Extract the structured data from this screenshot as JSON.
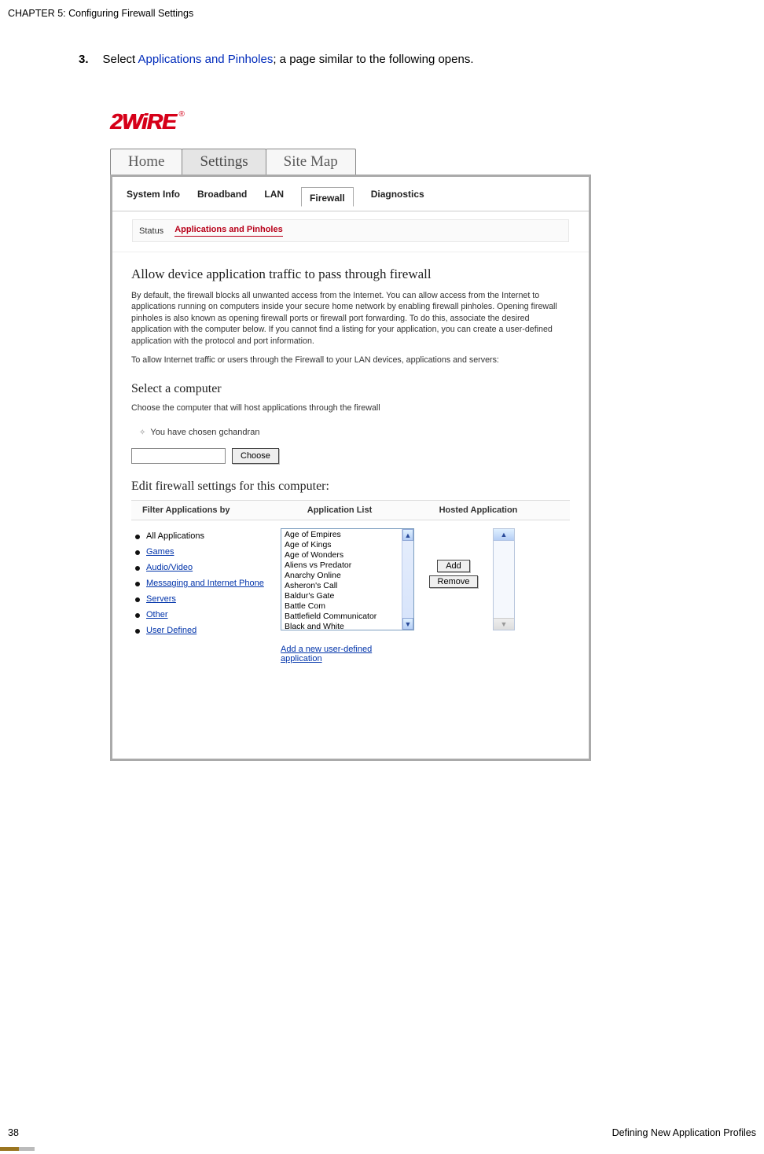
{
  "doc": {
    "chapter": "CHAPTER 5: Configuring Firewall Settings",
    "step_num": "3.",
    "step_pre": "Select ",
    "step_link": "Applications and Pinholes",
    "step_post": "; a page similar to the following opens.",
    "footer_left": "38",
    "footer_right": "Defining New Application Profiles"
  },
  "ui": {
    "logo": "2WiRE",
    "main_tabs": {
      "home": "Home",
      "settings": "Settings",
      "sitemap": "Site Map"
    },
    "sub_tabs": {
      "system": "System Info",
      "broadband": "Broadband",
      "lan": "LAN",
      "firewall": "Firewall",
      "diagnostics": "Diagnostics"
    },
    "status_label": "Status",
    "status_link": "Applications and Pinholes",
    "heading1": "Allow device application traffic to pass through firewall",
    "para1": "By default, the firewall blocks all unwanted access from the Internet. You can allow access from the Internet to applications running on computers inside your secure home network by enabling firewall pinholes. Opening firewall pinholes is also known as opening firewall ports or firewall port forwarding. To do this, associate the desired application with the computer below. If you cannot find a listing for your application, you can create a user-defined application with the protocol and port information.",
    "para2": "To allow Internet traffic or users through the Firewall to your LAN devices, applications and servers:",
    "heading2": "Select a computer",
    "para3": "Choose the computer that will host applications through the firewall",
    "chosen": "You have chosen gchandran",
    "choose_btn": "Choose",
    "heading3": "Edit firewall settings for this computer:",
    "col_filter": "Filter Applications by",
    "col_applist": "Application List",
    "col_hosted": "Hosted Application",
    "filters": [
      "All Applications",
      "Games",
      "Audio/Video",
      "Messaging and Internet Phone",
      "Servers",
      "Other",
      "User Defined"
    ],
    "apps": [
      "Age of Empires",
      "Age of Kings",
      "Age of Wonders",
      "Aliens vs Predator",
      "Anarchy Online",
      "Asheron's Call",
      "Baldur's Gate",
      "Battle Com",
      "Battlefield Communicator",
      "Black and White"
    ],
    "add_btn": "Add",
    "remove_btn": "Remove",
    "add_new": "Add a new user-defined application"
  }
}
